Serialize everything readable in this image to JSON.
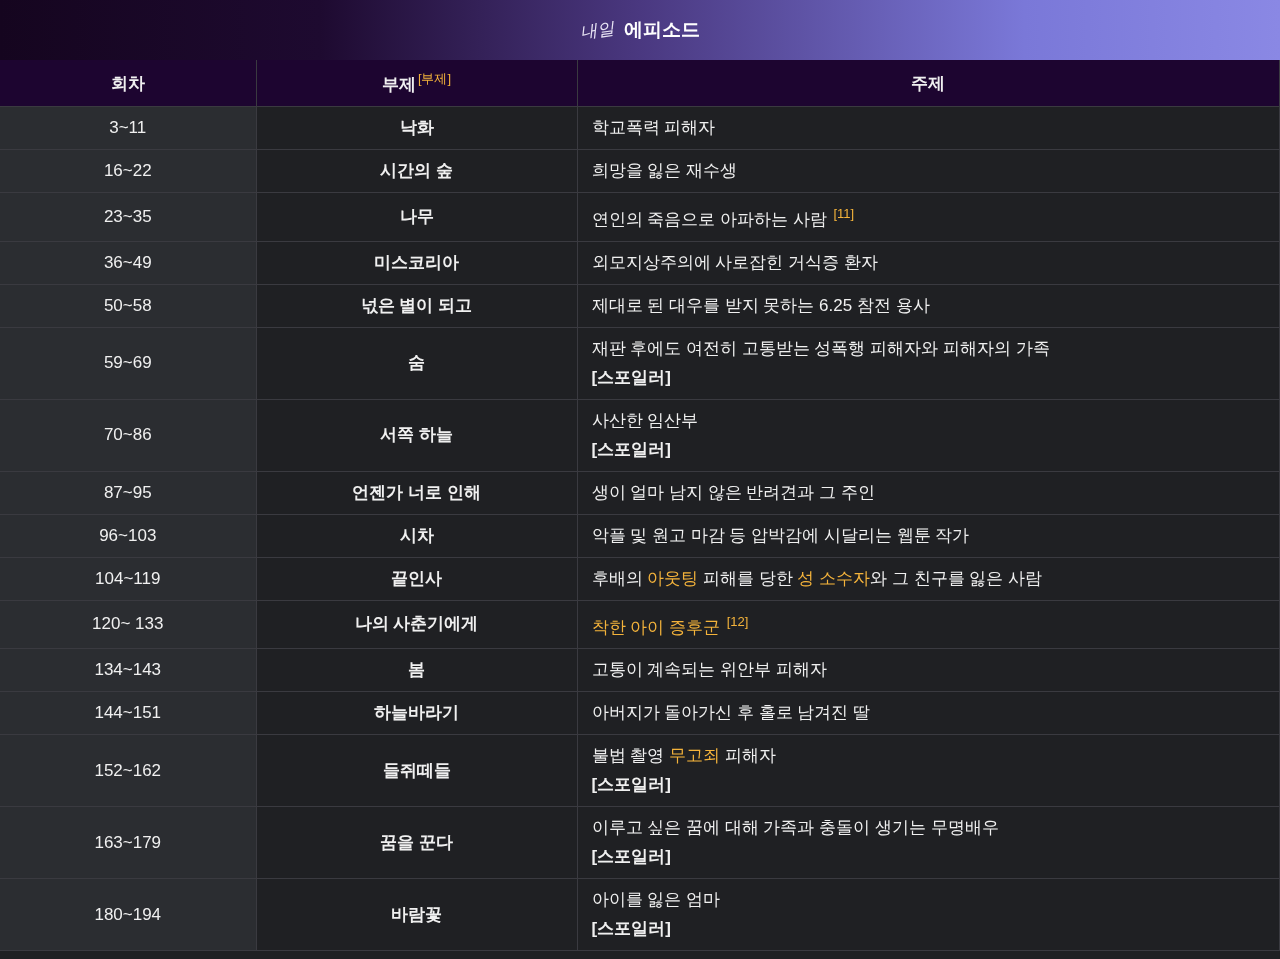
{
  "title": {
    "logo": "내일",
    "text": "에피소드"
  },
  "columns": [
    {
      "label": "회차"
    },
    {
      "label": "부제",
      "footnote": "[부제]"
    },
    {
      "label": "주제"
    }
  ],
  "rows": [
    {
      "episodes": "3~11",
      "subtitle": "낙화",
      "topic": [
        {
          "text": "학교폭력 피해자",
          "link": false
        }
      ]
    },
    {
      "episodes": "16~22",
      "subtitle": "시간의 숲",
      "topic": [
        {
          "text": "희망을 잃은 재수생",
          "link": false
        }
      ]
    },
    {
      "episodes": "23~35",
      "subtitle": "나무",
      "topic": [
        {
          "text": "연인의 죽음으로 아파하는 사람",
          "link": false
        }
      ],
      "footnote": "[11]"
    },
    {
      "episodes": "36~49",
      "subtitle": "미스코리아",
      "topic": [
        {
          "text": "외모지상주의에 사로잡힌 거식증 환자",
          "link": false
        }
      ]
    },
    {
      "episodes": "50~58",
      "subtitle": "넋은 별이 되고",
      "topic": [
        {
          "text": "제대로 된 대우를 받지 못하는 6.25 참전 용사",
          "link": false
        }
      ]
    },
    {
      "episodes": "59~69",
      "subtitle": "숨",
      "topic": [
        {
          "text": "재판 후에도 여전히 고통받는 성폭행 피해자와 피해자의 가족",
          "link": false
        }
      ],
      "spoiler": "[스포일러]"
    },
    {
      "episodes": "70~86",
      "subtitle": "서쪽 하늘",
      "topic": [
        {
          "text": "사산한 임산부",
          "link": false
        }
      ],
      "spoiler": "[스포일러]"
    },
    {
      "episodes": "87~95",
      "subtitle": "언젠가 너로 인해",
      "topic": [
        {
          "text": "생이 얼마 남지 않은 반려견과 그 주인",
          "link": false
        }
      ]
    },
    {
      "episodes": "96~103",
      "subtitle": "시차",
      "topic": [
        {
          "text": "악플 및 원고 마감 등 압박감에 시달리는 웹툰 작가",
          "link": false
        }
      ]
    },
    {
      "episodes": "104~119",
      "subtitle": "끝인사",
      "topic": [
        {
          "text": "후배의 ",
          "link": false
        },
        {
          "text": "아웃팅",
          "link": true
        },
        {
          "text": " 피해를 당한 ",
          "link": false
        },
        {
          "text": "성 소수자",
          "link": true
        },
        {
          "text": "와 그 친구를 잃은 사람",
          "link": false
        }
      ]
    },
    {
      "episodes": "120~ 133",
      "subtitle": "나의 사춘기에게",
      "topic": [
        {
          "text": "착한 아이 증후군",
          "link": true
        }
      ],
      "footnote": "[12]"
    },
    {
      "episodes": "134~143",
      "subtitle": "봄",
      "topic": [
        {
          "text": "고통이 계속되는 위안부 피해자",
          "link": false
        }
      ]
    },
    {
      "episodes": "144~151",
      "subtitle": "하늘바라기",
      "topic": [
        {
          "text": "아버지가 돌아가신 후 홀로 남겨진 딸",
          "link": false
        }
      ]
    },
    {
      "episodes": "152~162",
      "subtitle": "들쥐떼들",
      "topic": [
        {
          "text": "불법 촬영 ",
          "link": false
        },
        {
          "text": "무고죄",
          "link": true
        },
        {
          "text": " 피해자",
          "link": false
        }
      ],
      "spoiler": "[스포일러]"
    },
    {
      "episodes": "163~179",
      "subtitle": "꿈을 꾼다",
      "topic": [
        {
          "text": "이루고 싶은 꿈에 대해 가족과 충돌이 생기는 무명배우",
          "link": false
        }
      ],
      "spoiler": "[스포일러]"
    },
    {
      "episodes": "180~194",
      "subtitle": "바람꽃",
      "topic": [
        {
          "text": "아이를 잃은 엄마",
          "link": false
        }
      ],
      "spoiler": "[스포일러]"
    }
  ]
}
